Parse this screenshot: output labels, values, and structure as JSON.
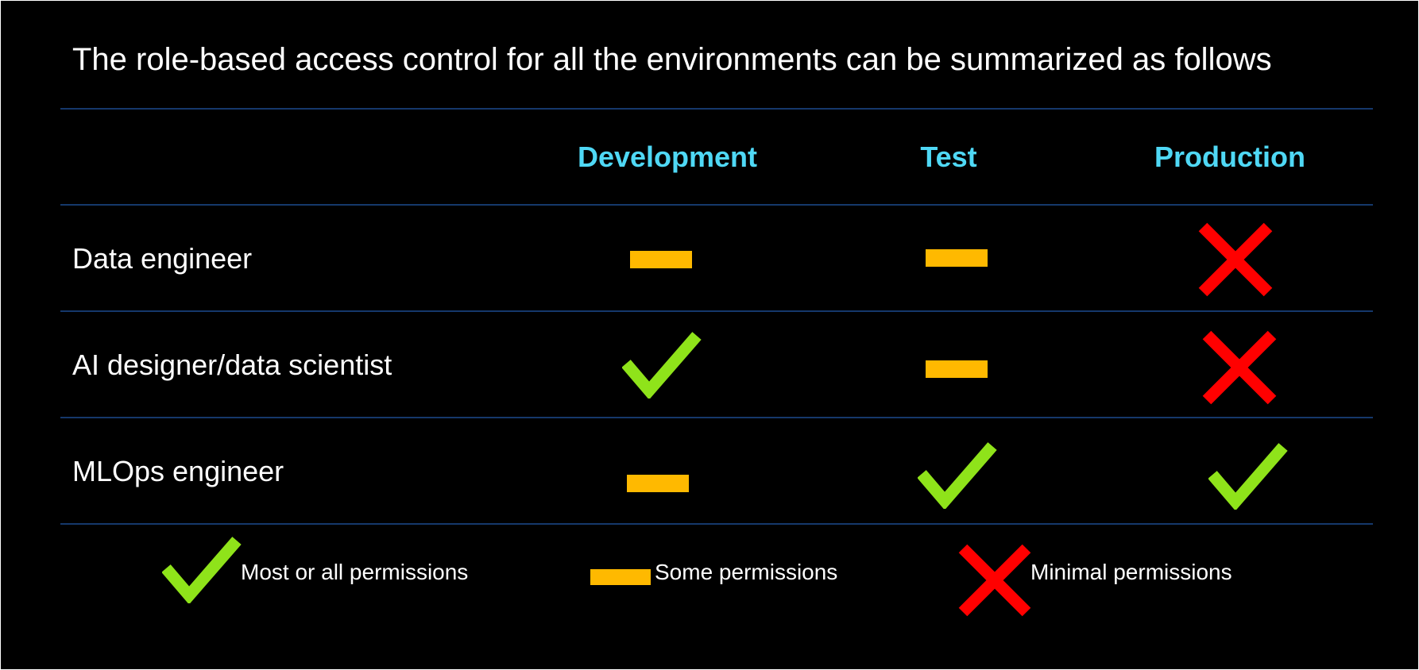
{
  "title": "The role-based access control for all the environments can be summarized as follows",
  "columns": [
    {
      "key": "development",
      "label": "Development"
    },
    {
      "key": "test",
      "label": "Test"
    },
    {
      "key": "production",
      "label": "Production"
    }
  ],
  "rows": [
    {
      "label": "Data engineer",
      "development": "some",
      "test": "some",
      "production": "minimal"
    },
    {
      "label": "AI designer/data scientist",
      "development": "most",
      "test": "some",
      "production": "minimal"
    },
    {
      "label": "MLOps engineer",
      "development": "some",
      "test": "most",
      "production": "most"
    }
  ],
  "legend": {
    "most": "Most or all permissions",
    "some": "Some permissions",
    "minimal": "Minimal permissions"
  },
  "icons": {
    "most": "check-mark-icon",
    "some": "dash-icon",
    "minimal": "x-mark-icon"
  },
  "colors": {
    "background": "#000000",
    "header": "#4fd8f5",
    "divider": "#15386b",
    "check": "#8fe31a",
    "dash": "#ffb900",
    "cross": "#ff0000"
  }
}
